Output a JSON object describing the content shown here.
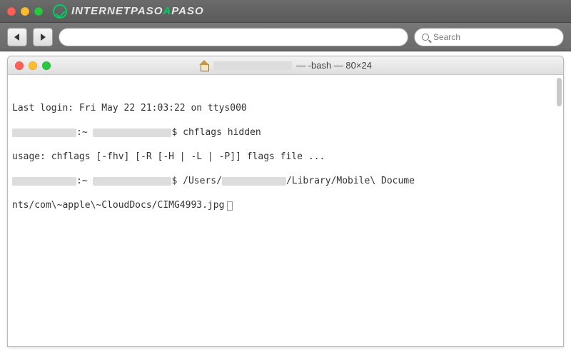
{
  "browser": {
    "brand_pre": "INTERNET",
    "brand_mid": "PASO",
    "brand_accent": "A",
    "brand_post": "PASO",
    "search_placeholder": "Search"
  },
  "terminal": {
    "title_suffix": " — -bash — 80×24",
    "lines": {
      "l1": "Last login: Fri May 22 21:03:22 on ttys000",
      "l2_mid": ":~ ",
      "l2_cmd": "$ chflags hidden",
      "l3": "usage: chflags [-fhv] [-R [-H | -L | -P]] flags file ...",
      "l4_mid": ":~ ",
      "l4_a": "$ /Users/",
      "l4_b": "/Library/Mobile\\ Docume",
      "l5": "nts/com\\~apple\\~CloudDocs/CIMG4993.jpg"
    }
  }
}
